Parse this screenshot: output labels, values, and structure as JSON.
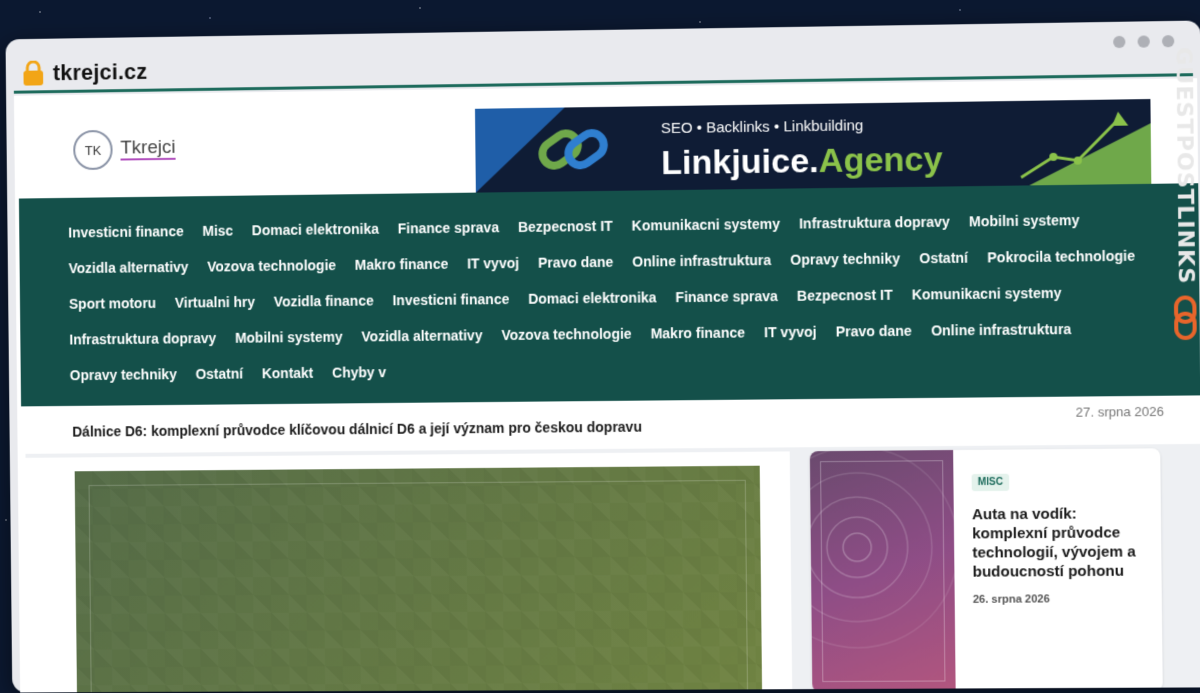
{
  "browser": {
    "url": "tkrejci.cz",
    "accent_color": "#1d6b5c"
  },
  "site": {
    "logo_mark": "TK",
    "logo_text": "Tkrejci"
  },
  "banner": {
    "tagline": "SEO  •  Backlinks  •  Linkbuilding",
    "brand_main": "Linkjuice.",
    "brand_accent": "Agency",
    "icons": [
      "chain-link-icon",
      "growth-chart-icon"
    ]
  },
  "nav": {
    "background": "#14504a",
    "items": [
      "Investicni finance",
      "Misc",
      "Domaci elektronika",
      "Finance sprava",
      "Bezpecnost IT",
      "Komunikacni systemy",
      "Infrastruktura dopravy",
      "Mobilni systemy",
      "Vozidla alternativy",
      "Vozova technologie",
      "Makro finance",
      "IT vyvoj",
      "Pravo dane",
      "Online infrastruktura",
      "Opravy techniky",
      "Ostatní",
      "Pokrocila technologie",
      "Sport motoru",
      "Virtualni hry",
      "Vozidla finance",
      "Investicni finance",
      "Domaci elektronika",
      "Finance sprava",
      "Bezpecnost IT",
      "Komunikacni systemy",
      "Infrastruktura dopravy",
      "Mobilni systemy",
      "Vozidla alternativy",
      "Vozova technologie",
      "Makro finance",
      "IT vyvoj",
      "Pravo dane",
      "Online infrastruktura",
      "Opravy techniky",
      "Ostatní",
      "Kontakt",
      "Chyby v"
    ]
  },
  "ticker": {
    "headline": "Dálnice D6: komplexní průvodce klíčovou dálnicí D6 a její význam pro českou dopravu",
    "date": "27. srpna 2026"
  },
  "side_article": {
    "category": "MISC",
    "title": "Auta na vodík: komplexní průvodce technologií, vývojem a budoucností pohonu",
    "date": "26. srpna 2026"
  },
  "watermark": {
    "text": "GUESTPOSTLINKS",
    "icon": "chain-link-icon"
  }
}
